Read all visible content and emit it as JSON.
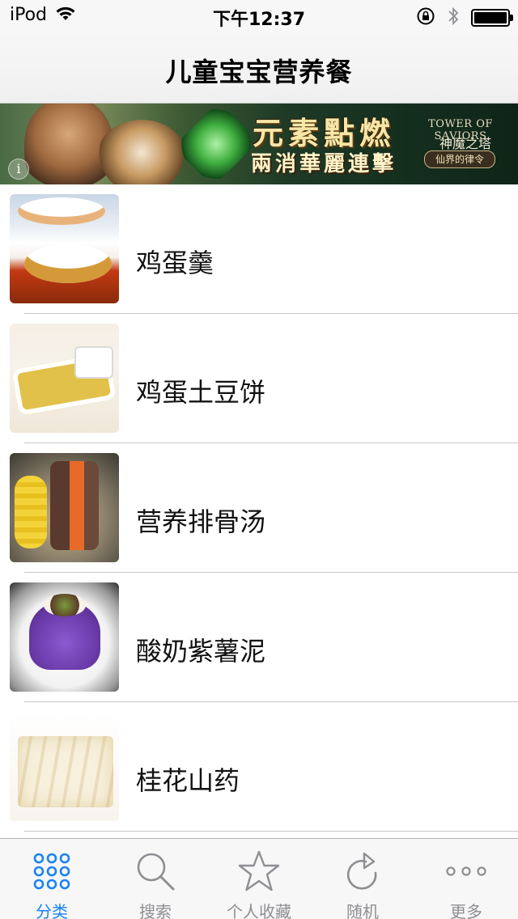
{
  "status_bar": {
    "carrier": "iPod",
    "time": "下午12:37",
    "battery_level": 1.0
  },
  "nav": {
    "title": "儿童宝宝营养餐"
  },
  "banner": {
    "headline": "元素點燃",
    "subline": "兩消華麗連擊",
    "game_en": "TOWER OF SAVIORS",
    "game_cn": "神魔之塔",
    "tagline": "仙界的律令"
  },
  "recipes": [
    {
      "name": "鸡蛋羹"
    },
    {
      "name": "鸡蛋土豆饼"
    },
    {
      "name": "营养排骨汤"
    },
    {
      "name": "酸奶紫薯泥"
    },
    {
      "name": "桂花山药"
    }
  ],
  "tab_bar": {
    "active_color": "#1a82f7",
    "inactive_color": "#8e8e93",
    "tabs": [
      {
        "label": "分类",
        "icon": "grid-dots-icon",
        "active": true
      },
      {
        "label": "搜索",
        "icon": "search-icon",
        "active": false
      },
      {
        "label": "个人收藏",
        "icon": "star-icon",
        "active": false
      },
      {
        "label": "随机",
        "icon": "refresh-icon",
        "active": false
      },
      {
        "label": "更多",
        "icon": "more-icon",
        "active": false
      }
    ]
  }
}
